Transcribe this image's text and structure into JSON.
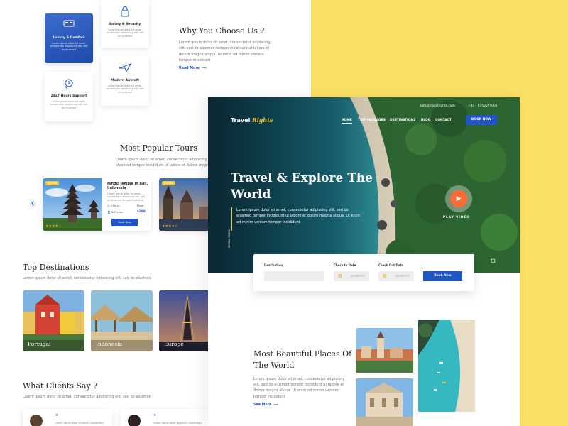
{
  "features": {
    "luxury": {
      "title": "Luxury & Comfort",
      "desc": "Lorem ipsum dolor sit amet, consectetur adipiscing elit, sed do eiusmod"
    },
    "safety": {
      "title": "Safety & Security",
      "desc": "Lorem ipsum dolor sit amet, consectetur adipiscing elit, sed do eiusmod"
    },
    "support": {
      "title": "24x7 Hours Support",
      "desc": "Lorem ipsum dolor sit amet, consectetur adipiscing elit, sed do eiusmod"
    },
    "aircraft": {
      "title": "Modern Aircraft",
      "desc": "Lorem ipsum dolor sit amet, consectetur adipiscing elit, sed do eiusmod"
    }
  },
  "why": {
    "title": "Why You Choose Us ?",
    "text": "Lorem ipsum dolor sit amet, consectetur adipiscing elit, sed do eiusmod tempor incididunt ut labore et dolore magna aliqua. Ut enim ad minim veniam tempor incididunt",
    "link": "Read More"
  },
  "tours": {
    "title": "Most Popular Tours",
    "subtitle": "Lorem ipsum dolor sit amet, consectetur adipiscing elit, sed do eiusmod tempor incididunt ut labore et dolore magna",
    "cards": [
      {
        "badge": "Popular",
        "name": "Hindu Temple In Bali, Indonesia",
        "desc": "Lorem ipsum dolor sit amet, consectetur adipiscing elit, sed do eiusmod tempor incididunt",
        "days": "4 Days",
        "persons": "2 Person",
        "from": "From",
        "price": "$380",
        "button": "Book Now",
        "rating": 4
      },
      {
        "badge": "Popular",
        "rating": 4
      }
    ]
  },
  "destinations": {
    "title": "Top Destinations",
    "subtitle": "Lorem ipsum dolor sit amet, consectetur adipiscing elit, sed do eiusmod",
    "items": [
      "Portugal",
      "Indonesia",
      "Europe"
    ]
  },
  "clients": {
    "title": "What Clients Say ?",
    "subtitle": "Lorem ipsum dolor sit amet, consectetur adipiscing elit, sed do eiusmod",
    "quote_mark": "❝",
    "card_text": "Lorem ipsum dolor sit amet, consectetur"
  },
  "hero": {
    "logo_main": "Travel",
    "logo_accent": "Rights",
    "email": "info@travelrights.com",
    "phone": "+91 - 9756675001",
    "nav": [
      "HOME",
      "TRIP PACKAGES",
      "DESTINATIONS",
      "BLOG",
      "CONTACT"
    ],
    "book_button": "BOOK NOW",
    "title": "Travel & Explore The World",
    "text": "Lorem ipsum dolor sit amet, consectetur adipiscing elit, sed do eiusmod tempor incididunt ut labore et dolore magna aliqua. Ut enim ad minim veniam tempor incididunt",
    "play_label": "PLAY VIDEO",
    "scroll_label": "SCROLL DOWN"
  },
  "search": {
    "destination_label": "Destination",
    "checkin_label": "Check In Date",
    "checkout_label": "Check Out Date",
    "date_placeholder": "DD-MM-YYYY",
    "button": "Book Now"
  },
  "places": {
    "title": "Most Beautiful Places Of The World",
    "text": "Lorem ipsum dolor sit amet, consectetur adipiscing elit, sed do eiusmod tempor incididunt ut labore et dolore magna aliqua. Ut enim ad minim veniam tempor incididunt",
    "link": "See More"
  },
  "colors": {
    "accent": "#1f55c7",
    "yellow": "#fbe066",
    "gold": "#f4c534",
    "orange": "#ff6b35"
  }
}
